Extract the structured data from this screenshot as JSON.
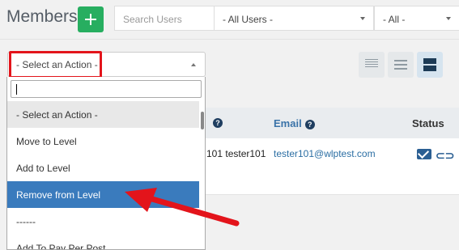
{
  "header": {
    "title": "Members",
    "search_placeholder": "Search Users",
    "users_filter": "- All Users -",
    "all_filter": "- All -"
  },
  "toolbar": {
    "action_select": "- Select an Action -"
  },
  "table": {
    "columns": {
      "email": "Email",
      "status": "Status",
      "help_glyph": "?"
    },
    "row": {
      "name": "101 tester101",
      "email": "tester101@wlptest.com"
    }
  },
  "dropdown": {
    "items": [
      "- Select an Action -",
      "Move to Level",
      "Add to Level",
      "Remove from Level",
      "------",
      "Add To Pay Per Post"
    ],
    "highlighted_index": 3
  },
  "colors": {
    "accent": "#27ae60",
    "highlight": "#3a7bbd",
    "annotation_red": "#e3141b",
    "link": "#2b6ea3"
  },
  "icons": [
    "plus-icon",
    "list-compact-icon",
    "list-icon",
    "grid-icon",
    "help-icon",
    "mail-icon",
    "link-icon"
  ]
}
